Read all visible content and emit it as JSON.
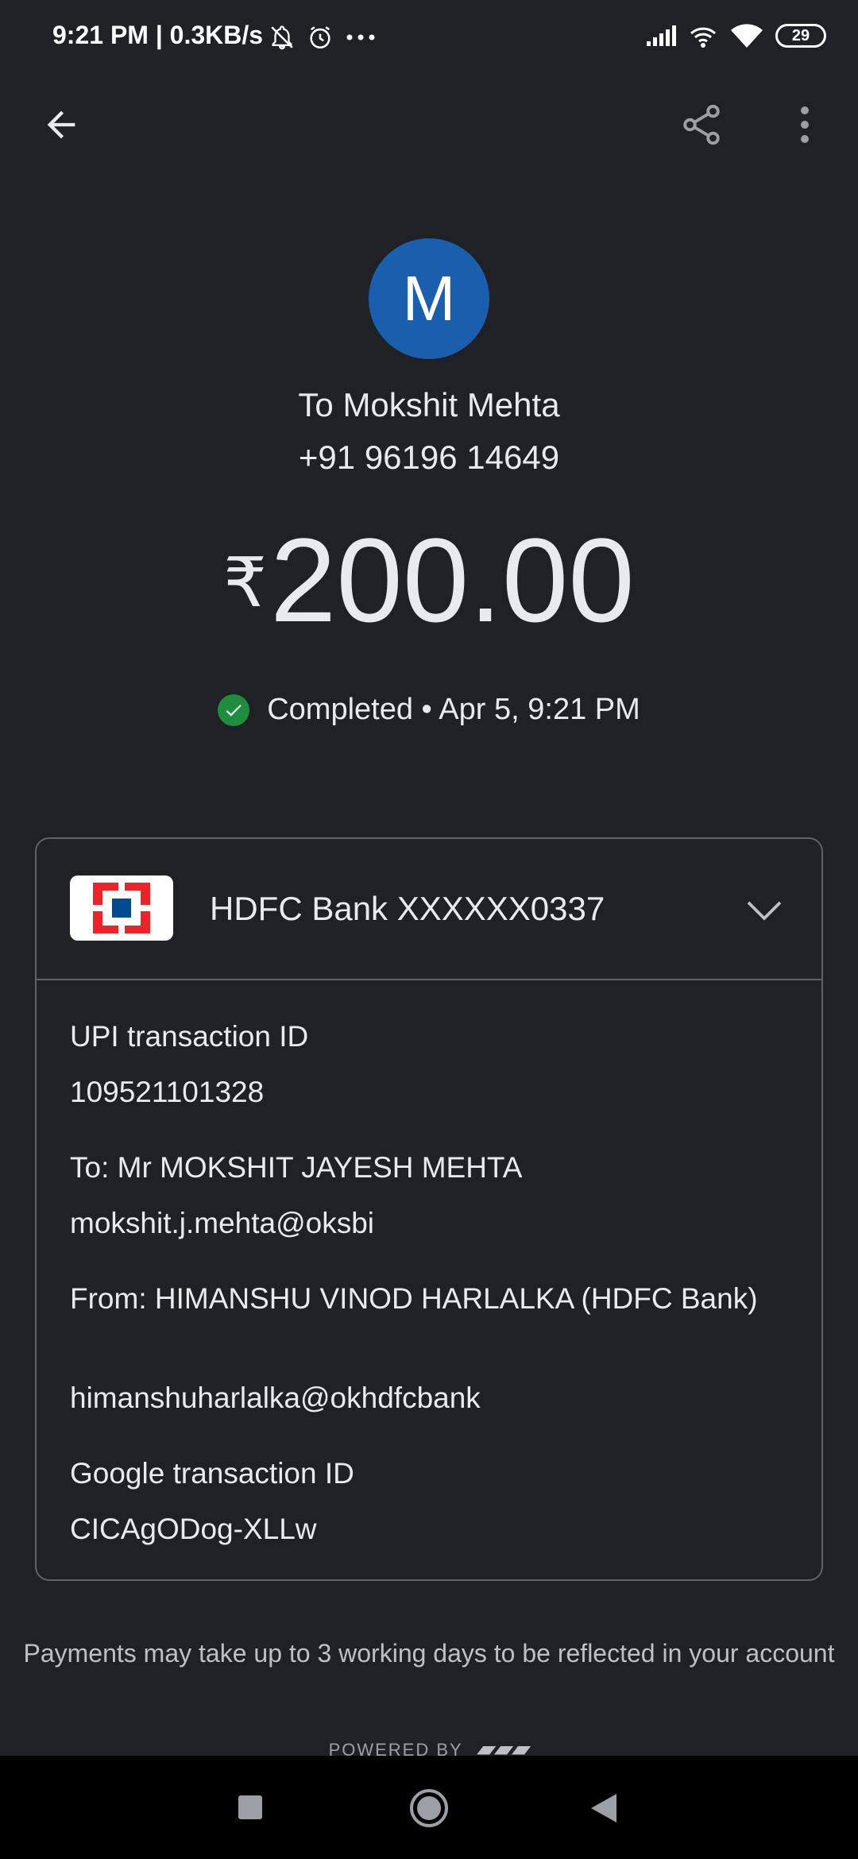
{
  "status_bar": {
    "time": "9:21 PM | 0.3KB/s",
    "battery": "29"
  },
  "app_bar": {
    "back_icon": "arrow-back-icon",
    "share_icon": "share-icon",
    "menu_icon": "more-vert-icon"
  },
  "payee": {
    "initial": "M",
    "avatar_color": "#1a5fae",
    "to_label": "To Mokshit Mehta",
    "phone": "+91 96196 14649"
  },
  "payment": {
    "currency": "₹",
    "amount": "200.00",
    "status_text": "Completed • Apr 5, 9:21 PM",
    "status_color": "#1e8e3e"
  },
  "card": {
    "bank_account": "HDFC Bank XXXXXX0337",
    "details": [
      {
        "label": "UPI transaction ID",
        "value": "109521101328"
      },
      {
        "label": "To: Mr MOKSHIT JAYESH MEHTA",
        "value": "mokshit.j.mehta@oksbi"
      },
      {
        "label": "From: HIMANSHU VINOD HARLALKA (HDFC Bank)",
        "value": "himanshuharlalka@okhdfcbank"
      },
      {
        "label": "Google transaction ID",
        "value": "CICAgODog-XLLw"
      }
    ]
  },
  "footer": {
    "note": "Payments may take up to 3 working days to be reflected in your account",
    "powered_by": "POWERED BY"
  },
  "colors": {
    "background": "#202124",
    "text": "#e8eaed"
  }
}
